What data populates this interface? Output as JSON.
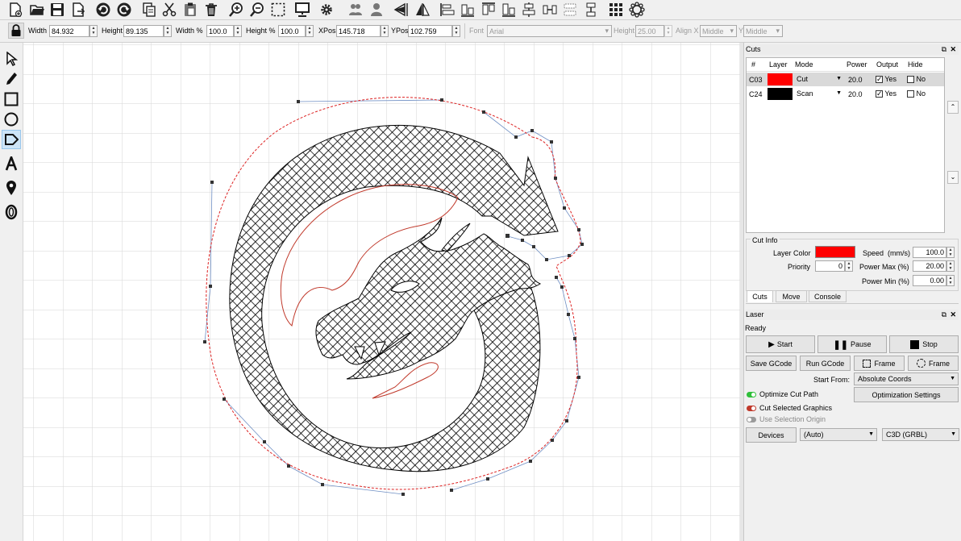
{
  "toolbar": {
    "icons": [
      "new-icon",
      "open-icon",
      "save-icon",
      "export-icon",
      "undo-icon",
      "redo-icon",
      "copy-icon",
      "cut-icon",
      "paste-icon",
      "delete-icon",
      "zoom-in-icon",
      "zoom-out-icon",
      "frame-select-icon",
      "monitor-icon",
      "settings-icon",
      "group-icon",
      "user-icon",
      "mirror-horizontal-icon",
      "mirror-vertical-icon",
      "align-left-icon",
      "align-center-icon",
      "align-top-icon",
      "align-bottom-icon",
      "align-middle-icon",
      "distribute-horizontal-icon",
      "distribute-spacing-icon",
      "distribute-vertical-icon",
      "grid-array-icon",
      "circular-array-icon"
    ]
  },
  "propbar": {
    "width_label": "Width",
    "width_value": "84.932",
    "height_label": "Height",
    "height_value": "89.135",
    "width_pct_label": "Width %",
    "width_pct_value": "100.0",
    "height_pct_label": "Height %",
    "height_pct_value": "100.0",
    "xpos_label": "XPos",
    "xpos_value": "145.718",
    "ypos_label": "YPos",
    "ypos_value": "102.759",
    "font_label": "Font",
    "font_value": "Arial",
    "text_height_label": "Height",
    "text_height_value": "25.00",
    "align_x_label": "Align X",
    "align_x_value": "Middle",
    "align_y_label": "Y",
    "align_y_value": "Middle"
  },
  "cuts": {
    "title": "Cuts",
    "headers": {
      "num": "#",
      "layer": "Layer",
      "mode": "Mode",
      "power": "Power",
      "output": "Output",
      "hide": "Hide"
    },
    "rows": [
      {
        "num": "C03",
        "color": "#ff0000",
        "mode": "Cut",
        "power": "20.0",
        "output": "Yes",
        "hide": "No"
      },
      {
        "num": "C24",
        "color": "#000000",
        "mode": "Scan",
        "power": "20.0",
        "output": "Yes",
        "hide": "No"
      }
    ]
  },
  "cut_info": {
    "title": "Cut Info",
    "layer_color_label": "Layer Color",
    "layer_color": "#ff0000",
    "speed_label": "Speed",
    "speed_unit": "(mm/s)",
    "speed_value": "100.0",
    "priority_label": "Priority",
    "priority_value": "0",
    "power_max_label": "Power Max (%)",
    "power_max_value": "20.00",
    "power_min_label": "Power Min (%)",
    "power_min_value": "0.00"
  },
  "tabs": [
    "Cuts",
    "Move",
    "Console"
  ],
  "laser": {
    "title": "Laser",
    "status": "Ready",
    "start_label": "Start",
    "pause_label": "Pause",
    "stop_label": "Stop",
    "save_gcode_label": "Save GCode",
    "run_gcode_label": "Run GCode",
    "frame1_label": "Frame",
    "frame2_label": "Frame",
    "start_from_label": "Start From:",
    "start_from_value": "Absolute Coords",
    "optimize_label": "Optimize Cut Path",
    "optimize_color": "#2fbf3a",
    "optimization_settings_label": "Optimization Settings",
    "cut_selected_label": "Cut Selected Graphics",
    "cut_selected_color": "#c0392b",
    "use_selection_label": "Use Selection Origin",
    "devices_label": "Devices",
    "port_value": "(Auto)",
    "device_value": "C3D (GRBL)"
  }
}
